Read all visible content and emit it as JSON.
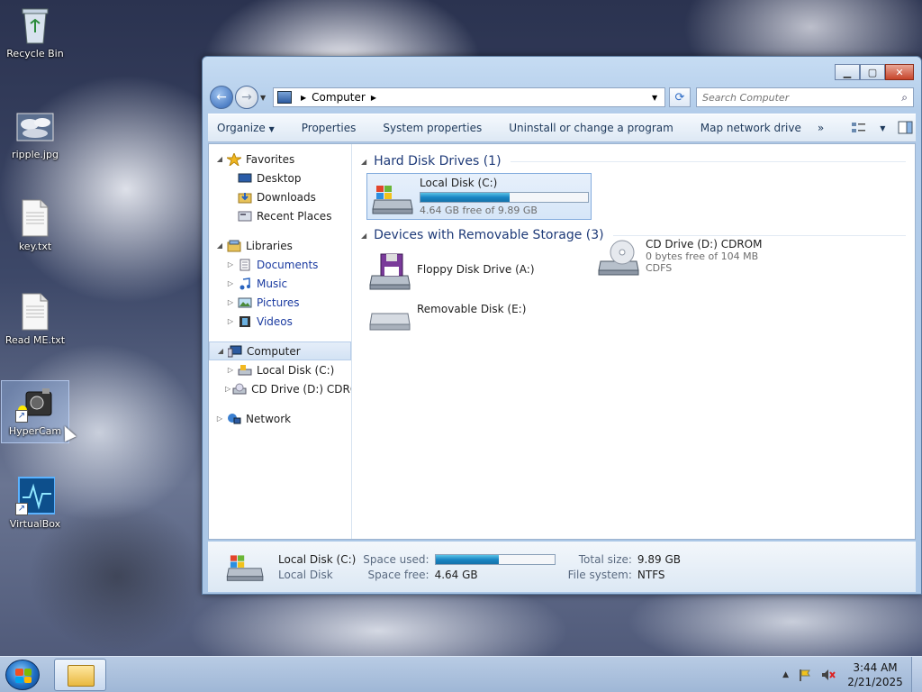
{
  "desktop": {
    "icons": [
      {
        "label": "Recycle Bin",
        "icon": "recycle-bin-icon"
      },
      {
        "label": "ripple.jpg",
        "icon": "image-file-icon"
      },
      {
        "label": "key.txt",
        "icon": "text-file-icon"
      },
      {
        "label": "Read ME.txt",
        "icon": "text-file-icon"
      },
      {
        "label": "HyperCam",
        "icon": "hypercam-icon"
      },
      {
        "label": "VirtualBox",
        "icon": "virtualbox-icon"
      }
    ]
  },
  "window": {
    "address": {
      "crumb": "Computer"
    },
    "search": {
      "placeholder": "Search Computer"
    },
    "toolbar": {
      "organize": "Organize",
      "properties": "Properties",
      "system_properties": "System properties",
      "uninstall": "Uninstall or change a program",
      "map_drive": "Map network drive",
      "more": "»"
    },
    "nav": {
      "favorites": {
        "label": "Favorites",
        "items": [
          "Desktop",
          "Downloads",
          "Recent Places"
        ]
      },
      "libraries": {
        "label": "Libraries",
        "items": [
          "Documents",
          "Music",
          "Pictures",
          "Videos"
        ]
      },
      "computer": {
        "label": "Computer",
        "items": [
          "Local Disk (C:)",
          "CD Drive (D:) CDROM"
        ]
      },
      "network": {
        "label": "Network"
      }
    },
    "sections": {
      "hdd": {
        "title": "Hard Disk Drives (1)"
      },
      "removable": {
        "title": "Devices with Removable Storage (3)"
      }
    },
    "drives": {
      "c": {
        "name": "Local Disk (C:)",
        "free_text": "4.64 GB free of 9.89 GB",
        "used_fraction": 0.53
      },
      "floppy": {
        "name": "Floppy Disk Drive (A:)"
      },
      "cd": {
        "name": "CD Drive (D:) CDROM",
        "line2": "0 bytes free of 104 MB",
        "line3": "CDFS"
      },
      "removable": {
        "name": "Removable Disk (E:)"
      }
    },
    "details": {
      "name": "Local Disk (C:)",
      "type": "Local Disk",
      "space_used_label": "Space used:",
      "space_free_label": "Space free:",
      "space_free": "4.64 GB",
      "total_size_label": "Total size:",
      "total_size": "9.89 GB",
      "file_system_label": "File system:",
      "file_system": "NTFS",
      "used_fraction": 0.53
    }
  },
  "taskbar": {
    "time": "3:44 AM",
    "date": "2/21/2025"
  },
  "colors": {
    "accent": "#1a86c4",
    "link": "#1a3aa0",
    "section_title": "#1e3a78"
  }
}
